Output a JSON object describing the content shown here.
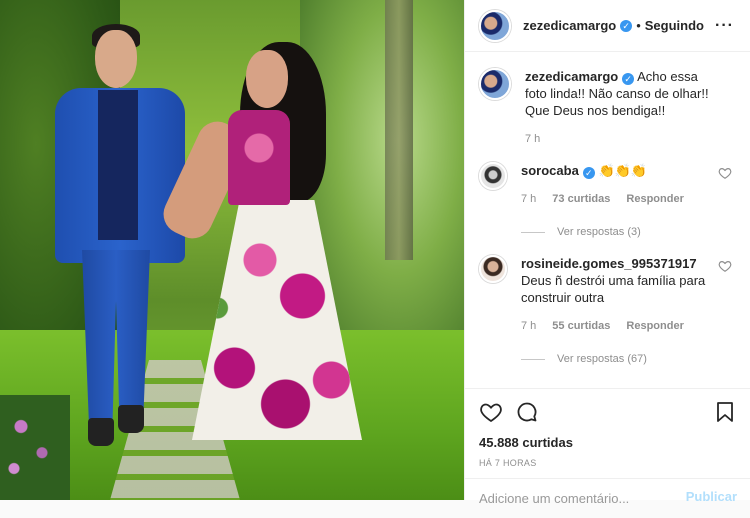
{
  "post": {
    "author": "zezedicamargo",
    "follow_status": "Seguindo",
    "caption": "Acho essa foto linda!! Não canso de olhar!! Que Deus nos bendiga!!",
    "caption_time": "7 h",
    "likes": "45.888 curtidas",
    "timestamp": "HÁ 7 HORAS",
    "comment_placeholder": "Adicione um comentário...",
    "publish_label": "Publicar"
  },
  "comments": [
    {
      "user": "sorocaba",
      "verified": true,
      "text": "👏👏👏",
      "time": "7 h",
      "likes": "73 curtidas",
      "reply_label": "Responder",
      "view_replies": "Ver respostas (3)"
    },
    {
      "user": "rosineide.gomes_995371917",
      "verified": false,
      "text": "Deus ñ destrói uma família para construir outra",
      "time": "7 h",
      "likes": "55 curtidas",
      "reply_label": "Responder",
      "view_replies": "Ver respostas (67)"
    }
  ],
  "icons": {
    "like": "heart-icon",
    "comment": "speech-bubble-icon",
    "save": "bookmark-icon",
    "more": "more-options-icon",
    "verified": "verified-badge-icon"
  },
  "colors": {
    "verified_blue": "#3897f0",
    "text_primary": "#262626",
    "text_secondary": "#8e8e8e",
    "publish_disabled": "#b2dffc"
  }
}
